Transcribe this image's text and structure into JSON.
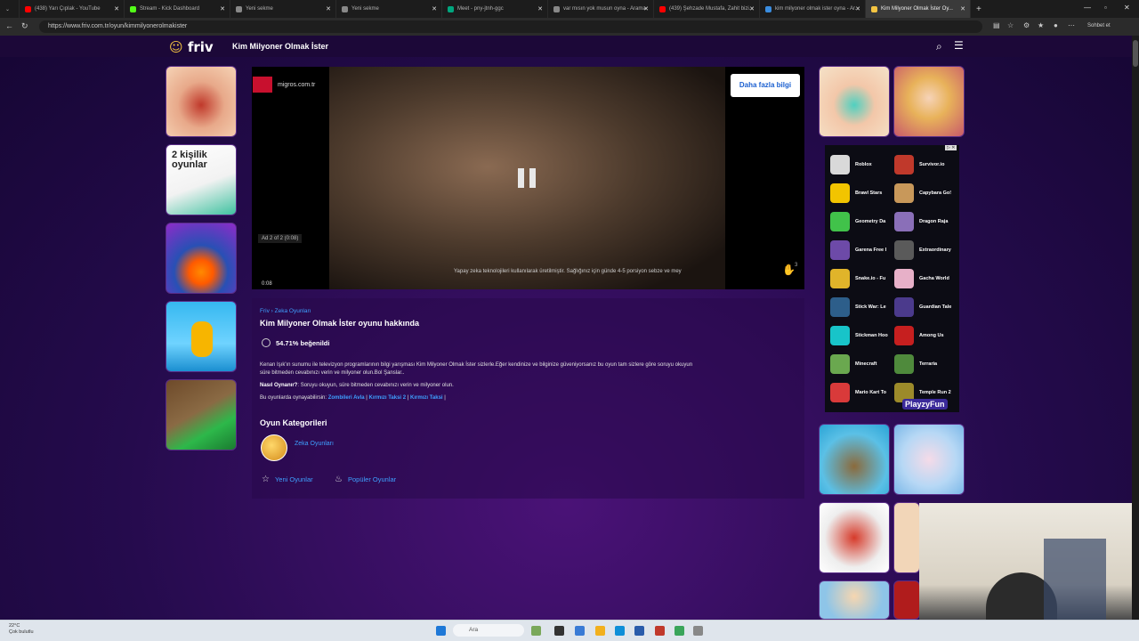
{
  "browser": {
    "tabs": [
      {
        "title": "(438) Yarı Çıplak - YouTube",
        "color": "#ff0000"
      },
      {
        "title": "Stream - Kick Dashboard",
        "color": "#53fc18"
      },
      {
        "title": "Yeni sekme",
        "color": "#888888"
      },
      {
        "title": "Yeni sekme",
        "color": "#888888"
      },
      {
        "title": "Meet - pny-jtnh-ggc",
        "color": "#00a67e"
      },
      {
        "title": "var mısın yok musun oyna - Arama",
        "color": "#888888"
      },
      {
        "title": "(439) Şehzade Mustafa, Zahit bizi...",
        "color": "#ff0000"
      },
      {
        "title": "kim milyoner olmak ister oyna - Ar...",
        "color": "#3a8de0"
      },
      {
        "title": "Kim Milyoner Olmak İster Oy...",
        "color": "#f5c542"
      }
    ],
    "url": "https://www.friv.com.tr/oyun/kimmilyonerolmakister",
    "profile_label": "Sohbet et"
  },
  "site": {
    "logo_text": "friv",
    "game_title": "Kim Milyoner Olmak İster"
  },
  "ad": {
    "advertiser": "migros.com.tr",
    "more_info": "Daha fazla bilgi",
    "ad_counter": "Ad 2 of 2 (0:08)",
    "subtitle": "Yapay zeka teknolojileri kullanılarak üretilmiştir. Sağlığınız için günde 4-5 porsiyon sebze ve mey",
    "time": "0:08",
    "corner_num": "3"
  },
  "info": {
    "breadcrumb_root": "Friv",
    "breadcrumb_sep": "›",
    "breadcrumb_cat": "Zeka Oyunları",
    "about_title": "Kim Milyoner Olmak İster oyunu hakkında",
    "likes": "54.71% beğenildi",
    "description": "Kenan Işık'ın sunumu ile televizyon programlarının bilgi yarışması Kim Milyoner Olmak İster sizlerle.Eğer kendinize ve bilginize güveniyorsanız bu oyun tam sizlere göre soruyu okuyun süre bitmeden cevabınızı verin ve milyoner olun.Bol Şanslar..",
    "howto_label": "Nasıl Oynanır?",
    "howto_text": ": Soruyu okuyun, süre bitmeden cevabınızı verin ve milyoner olun.",
    "alsoplay_label": "Bu oyunlarda oynayabilirsin:",
    "alsoplay_links": [
      "Zombileri Avla",
      "Kırmızı Taksi 2",
      "Kırmızı Taksi"
    ],
    "categories_title": "Oyun Kategorileri",
    "category_link": "Zeka Oyunları",
    "new_games": "Yeni Oyunlar",
    "popular_games": "Popüler Oyunlar"
  },
  "side_ad": {
    "badge": "▷ ✕",
    "brand": "PlayzyFun",
    "games_left": [
      "Roblox",
      "Brawl Stars",
      "Geometry Da",
      "Garena Free I",
      "Snake.io - Fu",
      "Stick War: Le",
      "Stickman Hoo",
      "Minecraft",
      "Mario Kart To"
    ],
    "games_right": [
      "Survivor.io",
      "Capybara Go!",
      "Dragon Raja",
      "Extraordinary",
      "Gacha World",
      "Guardian Tale",
      "Among Us",
      "Terraria",
      "Temple Run 2"
    ]
  },
  "left_thumbs": [
    "dentist-game",
    "2 kişilik oyunlar",
    "bubble-shooter",
    "run-game",
    "car-game"
  ],
  "taskbar": {
    "temperature": "22°C",
    "weather": "Çok bulutlu",
    "search_placeholder": "Ara"
  }
}
